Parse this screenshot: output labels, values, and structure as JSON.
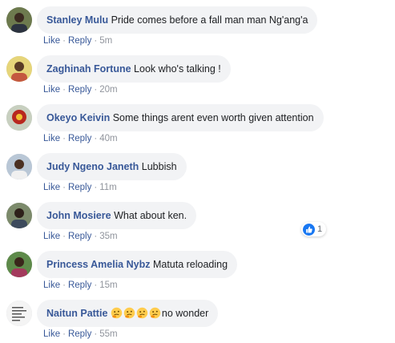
{
  "action_labels": {
    "like": "Like",
    "reply": "Reply",
    "separator": "·"
  },
  "comments": [
    {
      "author": "Stanley Mulu",
      "text": "Pride comes before a fall man man Ng'ang'a",
      "time": "5m"
    },
    {
      "author": "Zaghinah Fortune",
      "text": "Look who's talking !",
      "time": "20m"
    },
    {
      "author": "Okeyo Keivin",
      "text": "Some things arent even worth given attention",
      "time": "40m",
      "reactions": {
        "icon": "like-thumb-icon",
        "count": "1"
      }
    },
    {
      "author": "Judy Ngeno Janeth",
      "text": "Lubbish",
      "time": "11m"
    },
    {
      "author": "John Mosiere",
      "text": "What about ken.",
      "time": "35m"
    },
    {
      "author": "Princess Amelia Nybz",
      "text": "Matuta reloading",
      "time": "15m"
    },
    {
      "author": "Naitun Pattie",
      "emojis": [
        "thinking-face-icon",
        "thinking-face-icon",
        "thinking-face-icon",
        "thinking-face-icon"
      ],
      "text": "no wonder",
      "time": "55m"
    }
  ],
  "colors": {
    "author": "#385898",
    "bubble": "#f2f3f5",
    "meta": "#90949c",
    "like_reaction": "#1877f2"
  }
}
